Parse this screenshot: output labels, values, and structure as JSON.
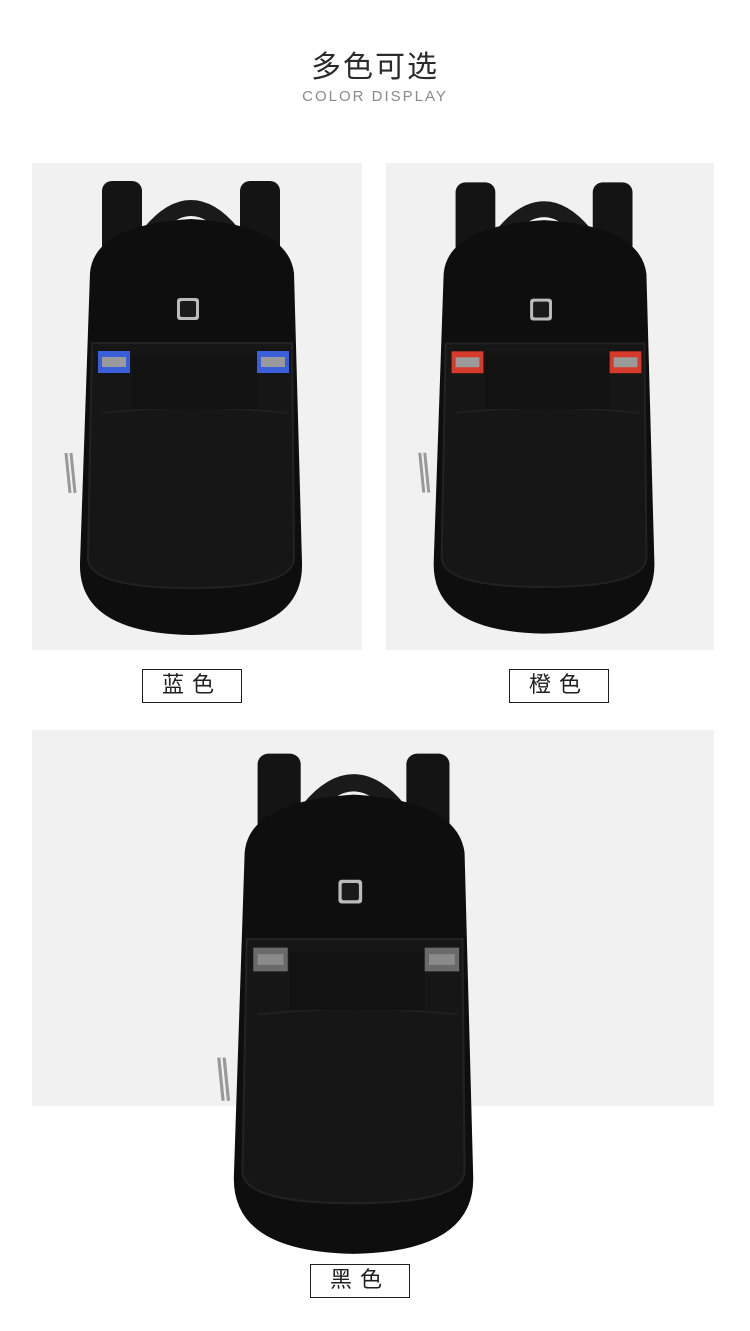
{
  "header": {
    "title": "多色可选",
    "subtitle": "COLOR DISPLAY"
  },
  "variants": [
    {
      "label": "蓝色",
      "stripe_color": "#3b5fd9"
    },
    {
      "label": "橙色",
      "stripe_color": "#d63a2a"
    },
    {
      "label": "黑色",
      "stripe_color": "#6a6a6a"
    }
  ]
}
